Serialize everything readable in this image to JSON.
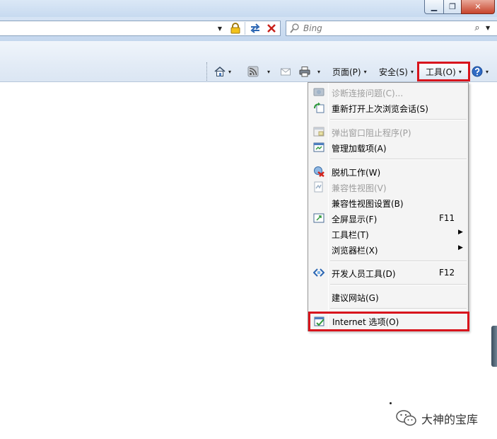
{
  "window": {
    "min_glyph": "▁",
    "max_glyph": "❐",
    "close_glyph": "✕"
  },
  "address": {
    "dropdown_glyph": "▼"
  },
  "search": {
    "placeholder": "Bing",
    "go_glyph": "⌕",
    "dropdown_glyph": "▼"
  },
  "commandbar": {
    "page_label": "页面(P)",
    "safety_label": "安全(S)",
    "tools_label": "工具(O)",
    "dropdown_glyph": "▾"
  },
  "tools_menu": {
    "items": [
      {
        "label": "诊断连接问题(C)...",
        "shortcut": "",
        "submenu": false,
        "disabled": true
      },
      {
        "label": "重新打开上次浏览会话(S)",
        "shortcut": "",
        "submenu": false,
        "disabled": false
      },
      {
        "label": "弹出窗口阻止程序(P)",
        "shortcut": "",
        "submenu": false,
        "disabled": true
      },
      {
        "label": "管理加载项(A)",
        "shortcut": "",
        "submenu": false,
        "disabled": false
      },
      {
        "label": "脱机工作(W)",
        "shortcut": "",
        "submenu": false,
        "disabled": false
      },
      {
        "label": "兼容性视图(V)",
        "shortcut": "",
        "submenu": false,
        "disabled": true
      },
      {
        "label": "兼容性视图设置(B)",
        "shortcut": "",
        "submenu": false,
        "disabled": false
      },
      {
        "label": "全屏显示(F)",
        "shortcut": "F11",
        "submenu": false,
        "disabled": false
      },
      {
        "label": "工具栏(T)",
        "shortcut": "",
        "submenu": true,
        "disabled": false
      },
      {
        "label": "浏览器栏(X)",
        "shortcut": "",
        "submenu": true,
        "disabled": false
      },
      {
        "label": "开发人员工具(D)",
        "shortcut": "F12",
        "submenu": false,
        "disabled": false
      },
      {
        "label": "建议网站(G)",
        "shortcut": "",
        "submenu": false,
        "disabled": false
      },
      {
        "label": "Internet 选项(O)",
        "shortcut": "",
        "submenu": false,
        "disabled": false
      }
    ],
    "submenu_glyph": "▶"
  },
  "watermark": {
    "text": "大神的宝库"
  },
  "colors": {
    "highlight_border": "#d8141c",
    "disabled_text": "#9d9d9d"
  }
}
